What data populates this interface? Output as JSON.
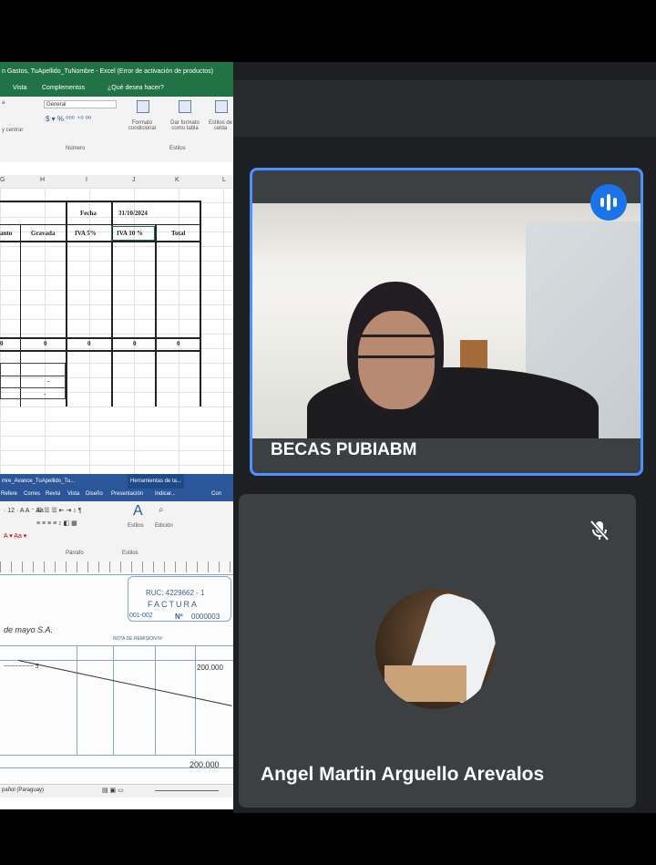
{
  "excel": {
    "title": "n Gastos, TuApellido_TuNombre - Excel (Error de activación de productos)",
    "menu": [
      "Vista",
      "Complementos",
      "¿Qué desea hacer?"
    ],
    "ribbon": {
      "alignment_label": "y centrar",
      "number_format": "General",
      "number_group": "Número",
      "styles_group": "Estilos",
      "cond_format": "Formato condicional",
      "table_format": "Dar formato como tabla",
      "cell_styles": "Estilos de celda"
    },
    "columns": [
      "G",
      "H",
      "I",
      "J",
      "K",
      "L"
    ],
    "header_label_date": "Fecha",
    "date": "31/10/2024",
    "headers": [
      "anto",
      "Gravada",
      "IVA 5%",
      "IVA 10 %",
      "Total"
    ],
    "totals": [
      "0",
      "0",
      "0",
      "0",
      "0"
    ],
    "dashes": [
      "-",
      "-"
    ]
  },
  "word": {
    "title": "mre_Avance_TuApellido_Tu...",
    "tools_label": "Herramientas de ta...",
    "tabs": [
      "Refere",
      "Corres",
      "Revisi",
      "Vista",
      "Diseño",
      "Presentación",
      "Indicar...",
      "Con"
    ],
    "ribbon": {
      "styles": "Estilos",
      "editing": "Edición",
      "paragraph": "Párrafo",
      "styles_group": "Estilos"
    },
    "invoice": {
      "ruc": "RUC: 4229662 - 1",
      "doc_type": "FACTURA",
      "serial": "001-002",
      "number_prefix": "Nº",
      "number": "0000003",
      "customer": "de mayo S.A.",
      "remission": "NOTA DE REMISION Nº",
      "amount_top": "200.000",
      "amount_bottom": "200.000"
    },
    "status_language": "pañol (Paraguay)"
  },
  "meet": {
    "participant1": "BECAS PUBIABM",
    "participant2": "Angel Martin Arguello Arevalos"
  },
  "colors": {
    "excel_green": "#217346",
    "word_blue": "#2b579a",
    "meet_bg": "#1e1f22",
    "tile": "#3c4043",
    "active_border": "#4d90fe",
    "speaking": "#1a73e8"
  },
  "icons": [
    "speaking-indicator-icon",
    "mic-off-icon",
    "styles-icon",
    "search-icon"
  ]
}
